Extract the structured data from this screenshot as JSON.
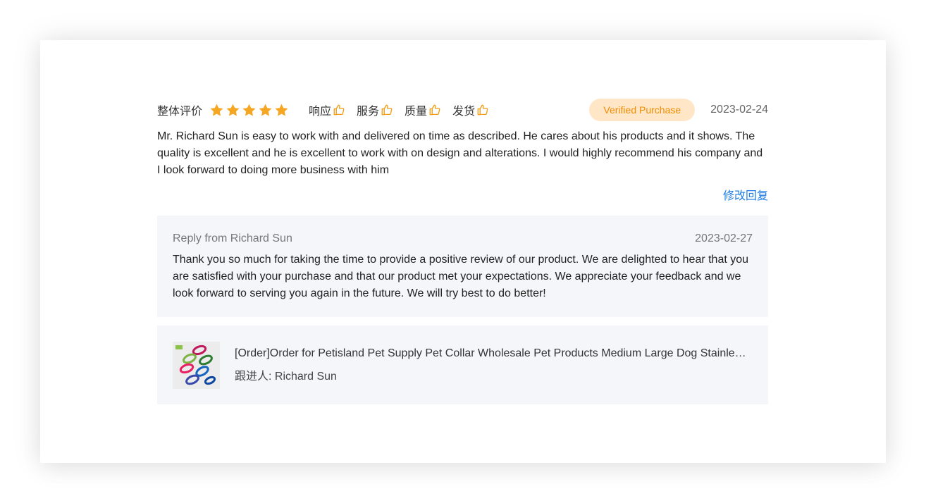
{
  "review": {
    "overall_label": "整体评价",
    "rating": 5,
    "metrics": [
      {
        "label": "响应",
        "icon": "thumbs-up-icon"
      },
      {
        "label": "服务",
        "icon": "thumbs-up-icon"
      },
      {
        "label": "质量",
        "icon": "thumbs-up-icon"
      },
      {
        "label": "发货",
        "icon": "thumbs-up-icon"
      }
    ],
    "badge": "Verified Purchase",
    "date": "2023-02-24",
    "text": "Mr. Richard Sun is easy to work with and delivered on time as described. He cares about his products and it shows. The quality is excellent and he is excellent to work with on design and alterations. I would highly recommend his company and I look forward to doing more business with him",
    "edit_reply_label": "修改回复"
  },
  "reply": {
    "from": "Reply from Richard Sun",
    "date": "2023-02-27",
    "text": "Thank you so much for taking the time to provide a positive review of our product. We are delighted to hear that you are satisfied with your purchase and that our product met your expectations. We appreciate your feedback and we look forward to serving you again in the future. We will try best to do better!"
  },
  "order": {
    "title": "[Order]Order for Petisland Pet Supply Pet Collar Wholesale Pet Products Medium Large Dog Stainless B...",
    "follow_up": "跟进人: Richard Sun"
  },
  "colors": {
    "star": "#f5a623",
    "thumb": "#f39c12",
    "badge_bg": "#ffe6c7",
    "badge_text": "#f08c00",
    "link": "#1e7ee6",
    "box_bg": "#f4f6fa"
  }
}
